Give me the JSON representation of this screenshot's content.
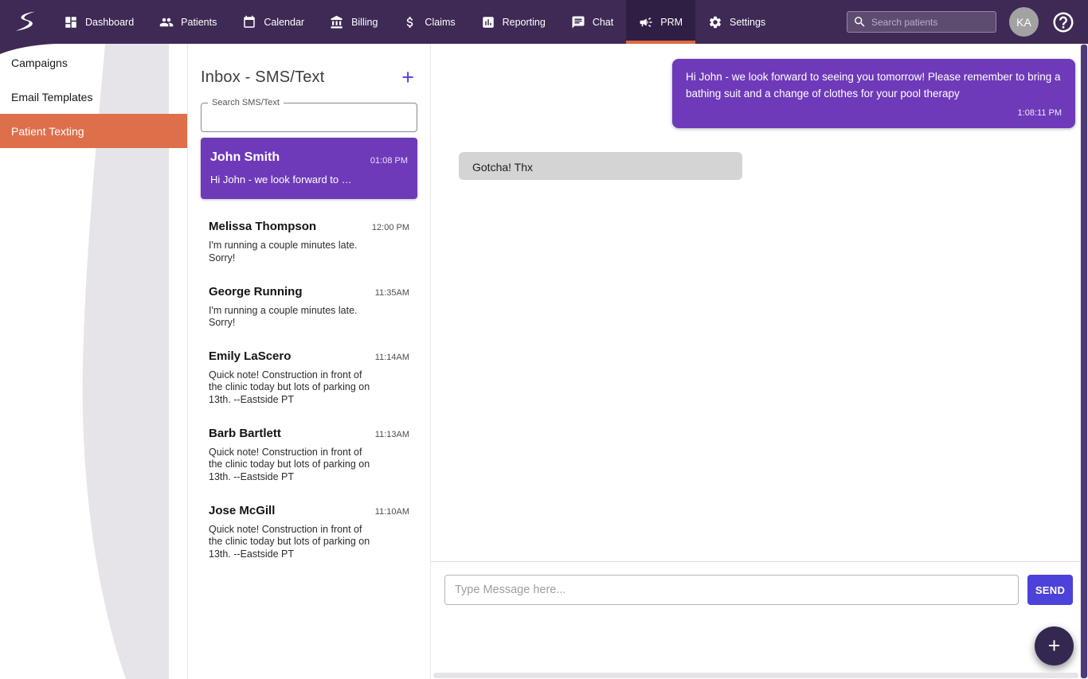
{
  "colors": {
    "nav_bg": "#3E2A55",
    "nav_active_bg": "#2F1F44",
    "accent_orange": "#E0693F",
    "sidebar_active": "#DE6F4B",
    "purple": "#6E3AB9",
    "indigo": "#4C42D9",
    "fab": "#342850",
    "incoming_bubble": "#D4D4D4",
    "avatar_bg": "#A2A2A2"
  },
  "topnav": {
    "items": [
      {
        "label": "Dashboard",
        "icon": "dashboard-icon",
        "active": false
      },
      {
        "label": "Patients",
        "icon": "patients-icon",
        "active": false
      },
      {
        "label": "Calendar",
        "icon": "calendar-icon",
        "active": false
      },
      {
        "label": "Billing",
        "icon": "billing-icon",
        "active": false
      },
      {
        "label": "Claims",
        "icon": "claims-icon",
        "active": false
      },
      {
        "label": "Reporting",
        "icon": "reporting-icon",
        "active": false
      },
      {
        "label": "Chat",
        "icon": "chat-icon",
        "active": false
      },
      {
        "label": "PRM",
        "icon": "megaphone-icon",
        "active": true
      },
      {
        "label": "Settings",
        "icon": "gear-icon",
        "active": false
      }
    ],
    "search": {
      "placeholder": "Search patients"
    },
    "avatar_initials": "KA"
  },
  "sidebar": {
    "items": [
      {
        "label": "Campaigns",
        "active": false
      },
      {
        "label": "Email Templates",
        "active": false
      },
      {
        "label": "Patient Texting",
        "active": true
      }
    ]
  },
  "inbox": {
    "title": "Inbox - SMS/Text",
    "add_label": "+",
    "search_label": "Search SMS/Text",
    "conversations": [
      {
        "name": "John Smith",
        "time": "01:08 PM",
        "preview": "Hi John - we look forward to …",
        "selected": true
      },
      {
        "name": "Melissa Thompson",
        "time": "12:00 PM",
        "preview": "I'm running a couple minutes late. Sorry!",
        "selected": false
      },
      {
        "name": "George Running",
        "time": "11:35AM",
        "preview": "I'm running a couple minutes late. Sorry!",
        "selected": false
      },
      {
        "name": "Emily LaScero",
        "time": "11:14AM",
        "preview": "Quick note! Construction in front of the clinic today but lots of parking on 13th. --Eastside PT",
        "selected": false
      },
      {
        "name": "Barb Bartlett",
        "time": "11:13AM",
        "preview": "Quick note! Construction in front of the clinic today but lots of parking on 13th. --Eastside PT",
        "selected": false
      },
      {
        "name": "Jose McGill",
        "time": "11:10AM",
        "preview": "Quick note! Construction in front of the clinic today but lots of parking on 13th. --Eastside PT",
        "selected": false
      }
    ]
  },
  "chat": {
    "messages": [
      {
        "direction": "outgoing",
        "text": "Hi John - we look forward to seeing you tomorrow! Please remember to bring a bathing suit and a change of clothes for your pool therapy",
        "time": "1:08:11 PM"
      },
      {
        "direction": "incoming",
        "text": "Gotcha! Thx",
        "time": ""
      }
    ],
    "input_placeholder": "Type Message here...",
    "send_label": "SEND",
    "fab_label": "+"
  }
}
